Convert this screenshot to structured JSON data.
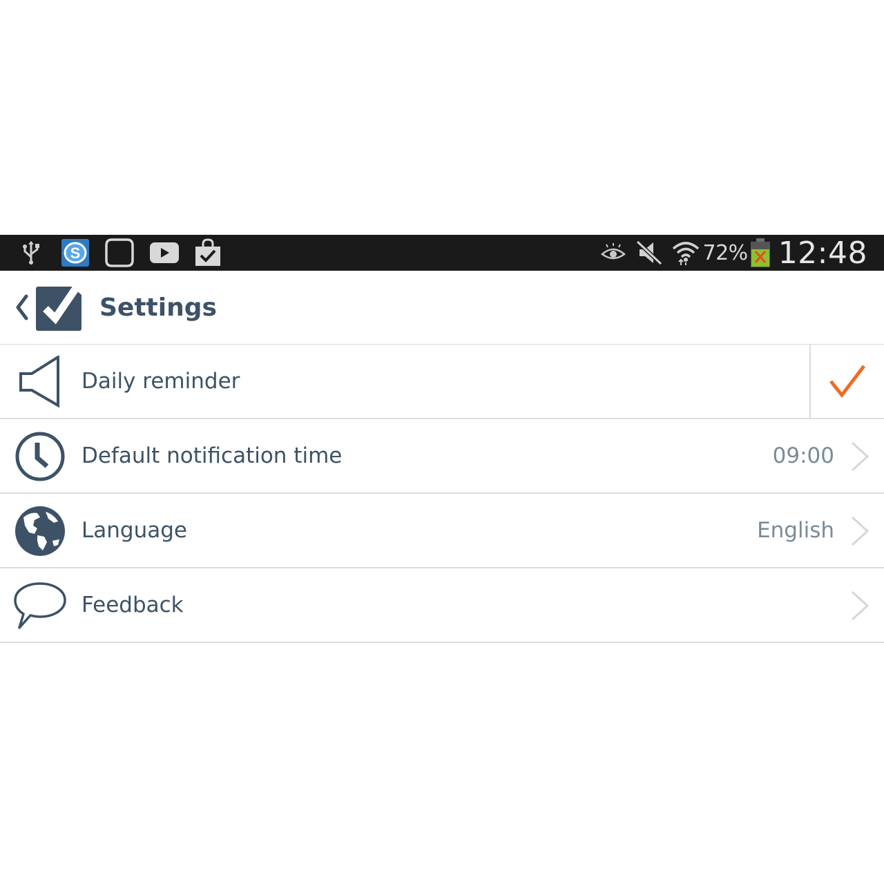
{
  "status_bar": {
    "battery_percent": "72%",
    "time": "12:48"
  },
  "app_bar": {
    "title": "Settings"
  },
  "settings": {
    "items": [
      {
        "label": "Daily reminder",
        "icon": "speaker-icon",
        "checked": true
      },
      {
        "label": "Default notification time",
        "icon": "clock-icon",
        "value": "09:00"
      },
      {
        "label": "Language",
        "icon": "globe-icon",
        "value": "English"
      },
      {
        "label": "Feedback",
        "icon": "speech-bubble-icon"
      }
    ]
  },
  "colors": {
    "status_bar_bg": "#1a1a1a",
    "text_primary": "#3d5266",
    "text_secondary": "#7b8a96",
    "accent_check": "#f26a21",
    "divider": "#dcdcdc"
  }
}
